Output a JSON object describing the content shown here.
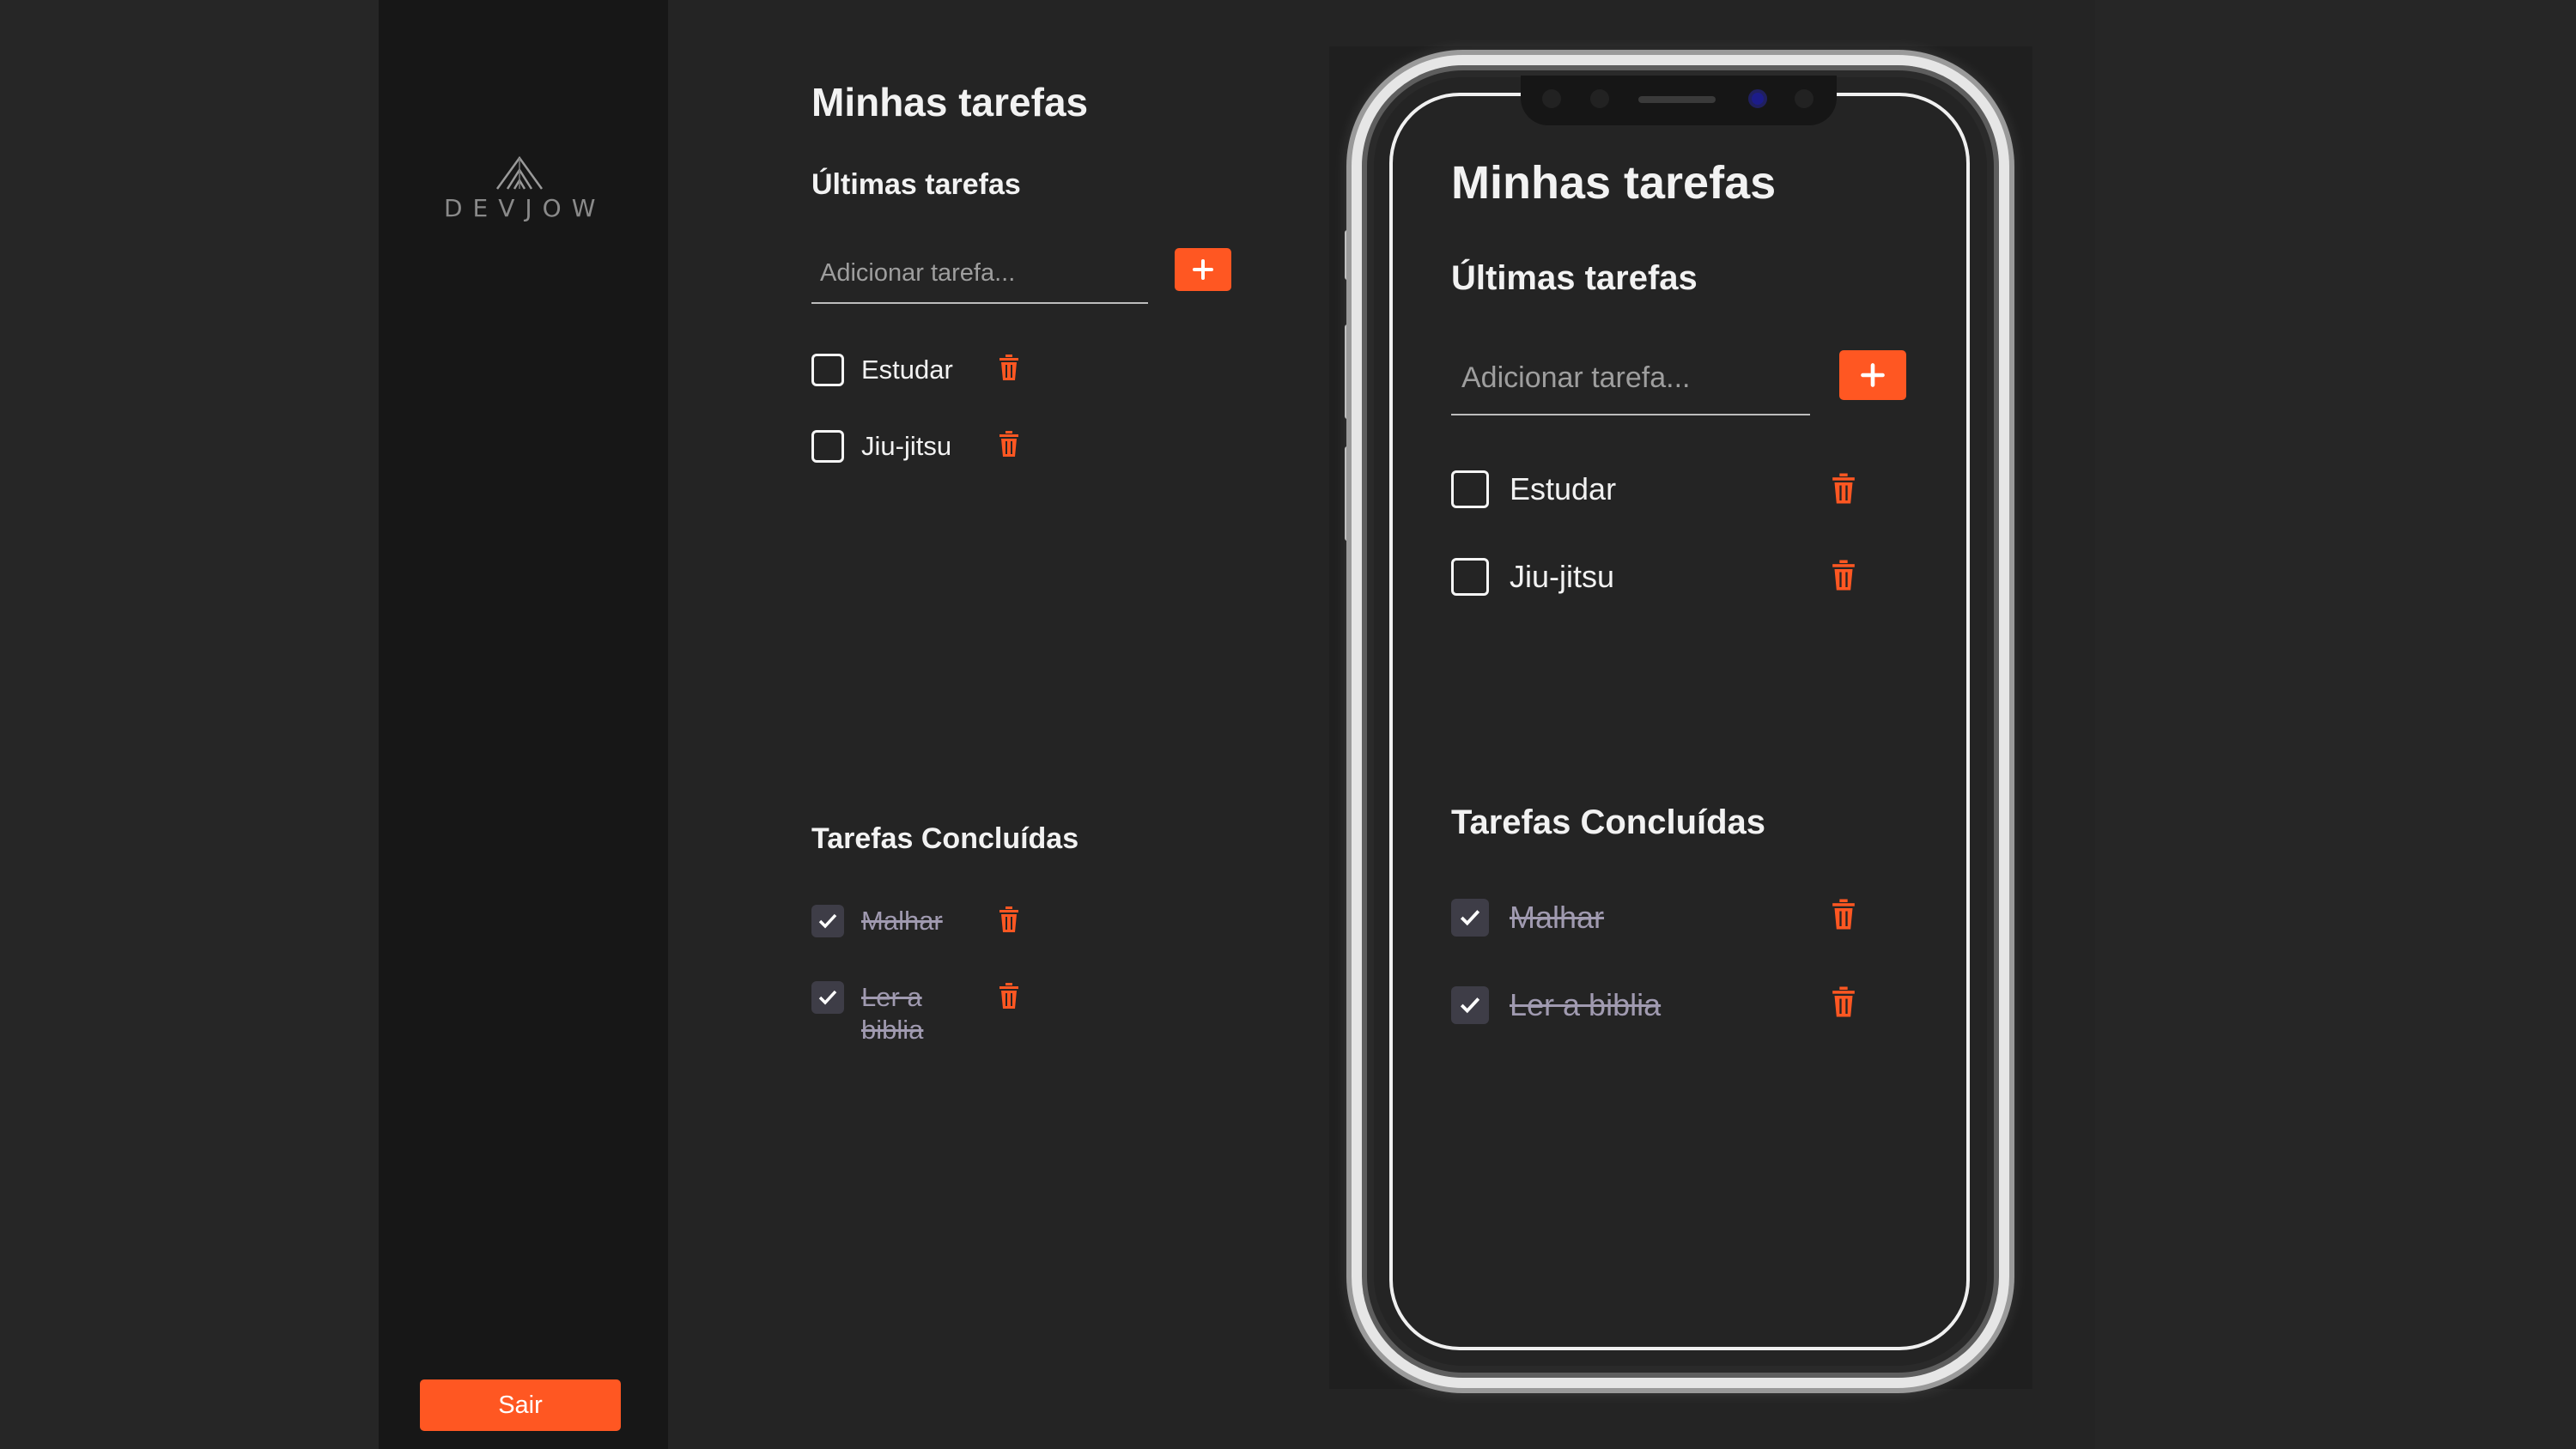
{
  "sidebar": {
    "logo_text": "DEVJOW",
    "logout_label": "Sair"
  },
  "desktop": {
    "title": "Minhas tarefas",
    "latest_title": "Últimas tarefas",
    "input_placeholder": "Adicionar tarefa...",
    "pending": [
      {
        "label": "Estudar"
      },
      {
        "label": "Jiu-jitsu"
      }
    ],
    "done_title": "Tarefas Concluídas",
    "done": [
      {
        "label": "Malhar"
      },
      {
        "label": "Ler a biblia"
      }
    ]
  },
  "mobile": {
    "title": "Minhas tarefas",
    "latest_title": "Últimas tarefas",
    "input_placeholder": "Adicionar tarefa...",
    "pending": [
      {
        "label": "Estudar"
      },
      {
        "label": "Jiu-jitsu"
      }
    ],
    "done_title": "Tarefas Concluídas",
    "done": [
      {
        "label": "Malhar"
      },
      {
        "label": "Ler a biblia"
      }
    ]
  },
  "colors": {
    "accent": "#ff5722",
    "sidebar_bg": "#171717",
    "main_bg": "#242424",
    "done_text": "#a09ab0"
  },
  "icons": {
    "add": "plus-icon",
    "delete": "trash-icon",
    "check": "checkmark-icon",
    "logo": "mountain-logo-icon"
  }
}
